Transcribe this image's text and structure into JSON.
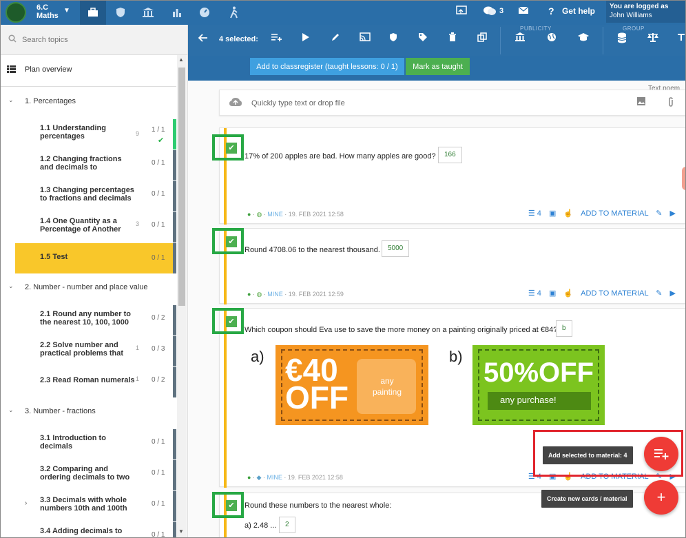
{
  "app": {
    "class_name_line1": "6.C",
    "class_name_line2": "Maths",
    "login_line1": "You are logged as",
    "login_line2": "John Williams",
    "help_label": "Get help",
    "chat_count": "3"
  },
  "sidebar": {
    "search_placeholder": "Search topics",
    "plan_label": "Plan overview",
    "chapters": [
      {
        "label": "1. Percentages"
      },
      {
        "label": "2. Number - number and place value"
      },
      {
        "label": "3. Number - fractions"
      }
    ],
    "lessons": [
      {
        "title": "1.1 Understanding percentages",
        "count": "9",
        "progress": "1 / 1"
      },
      {
        "title": "1.2 Changing fractions and decimals to",
        "count": "",
        "progress": "0 / 1"
      },
      {
        "title": "1.3 Changing percentages to fractions and decimals",
        "count": "",
        "progress": "0 / 1"
      },
      {
        "title": "1.4 One Quantity as a Percentage of Another",
        "count": "3",
        "progress": "0 / 1"
      },
      {
        "title": "1.5 Test",
        "count": "",
        "progress": "0 / 1"
      },
      {
        "title": "2.1 Round any number to the nearest 10, 100, 1000",
        "count": "",
        "progress": "0 / 2"
      },
      {
        "title": "2.2 Solve number and practical problems that",
        "count": "1",
        "progress": "0 / 3"
      },
      {
        "title": "2.3 Read Roman numerals",
        "count": "1",
        "progress": "0 / 2"
      },
      {
        "title": "3.1 Introduction to decimals",
        "count": "",
        "progress": "0 / 1"
      },
      {
        "title": "3.2 Comparing and ordering decimals to two",
        "count": "",
        "progress": "0 / 1"
      },
      {
        "title": "3.3 Decimals with whole numbers 10th and 100th",
        "count": "",
        "progress": "0 / 1"
      },
      {
        "title": "3.4 Adding decimals to",
        "count": "",
        "progress": "0 / 1"
      }
    ]
  },
  "toolbar": {
    "selected_label": "4 selected:",
    "publicity_label": "PUBLICITY",
    "group_label": "GROUP"
  },
  "actions": {
    "add_to_classregister": "Add to classregister (taught lessons: 0 / 1)",
    "mark_as_taught": "Mark as taught"
  },
  "content": {
    "corner_text": "Text poem",
    "quick_input_placeholder": "Quickly type text or drop file",
    "cards": [
      {
        "question": "17% of 200 apples are bad. How many apples are good?",
        "answer": "166",
        "owner": "MINE",
        "date": "19. FEB 2021 12:58",
        "stack_count": "4",
        "add_label": "ADD TO MATERIAL"
      },
      {
        "question": "Round 4708.06 to the nearest thousand.",
        "answer": "5000",
        "owner": "MINE",
        "date": "19. FEB 2021 12:59",
        "stack_count": "4",
        "add_label": "ADD TO MATERIAL"
      },
      {
        "question": "Which coupon should Eva use to save the more money on a painting originally priced at €84?",
        "answer": "b",
        "owner": "MINE",
        "date": "19. FEB 2021 12:58",
        "stack_count": "4",
        "add_label": "ADD TO MATERIAL"
      },
      {
        "question": "Round these numbers to the nearest whole:",
        "sub_label": "a) 2.48 ...",
        "answer": "2"
      }
    ],
    "coupon_a_label": "a)",
    "coupon_a_big_line1": "€40",
    "coupon_a_big_line2": "OFF",
    "coupon_a_small": "any painting",
    "coupon_b_label": "b)",
    "coupon_b_big": "50%OFF",
    "coupon_b_small": "any purchase!"
  },
  "fab": {
    "add_selected_tooltip": "Add selected to material: 4",
    "create_tooltip": "Create new cards / material"
  }
}
